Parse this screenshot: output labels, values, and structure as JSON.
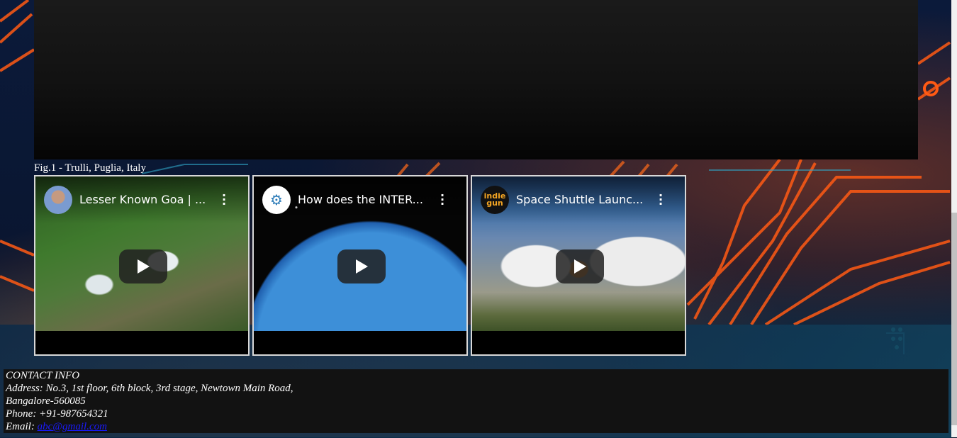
{
  "figure": {
    "caption": "Fig.1 - Trulli, Puglia, Italy"
  },
  "videos": [
    {
      "title": "Lesser Known Goa | ...",
      "avatar": ""
    },
    {
      "title": "How does the INTER...",
      "avatar": "⚙"
    },
    {
      "title": "Space Shuttle Launc...",
      "avatar": "indie gun"
    }
  ],
  "contact": {
    "heading": "CONTACT INFO",
    "address_line1": "Address: No.3, 1st floor, 6th block, 3rd stage, Newtown Main Road,",
    "address_line2": "Bangalore-560085",
    "phone": "Phone: +91-987654321",
    "email_label": "Email: ",
    "email": "abc@gmail.com"
  },
  "colors": {
    "accent": "#ff6a1a",
    "link": "#1a1aff"
  }
}
